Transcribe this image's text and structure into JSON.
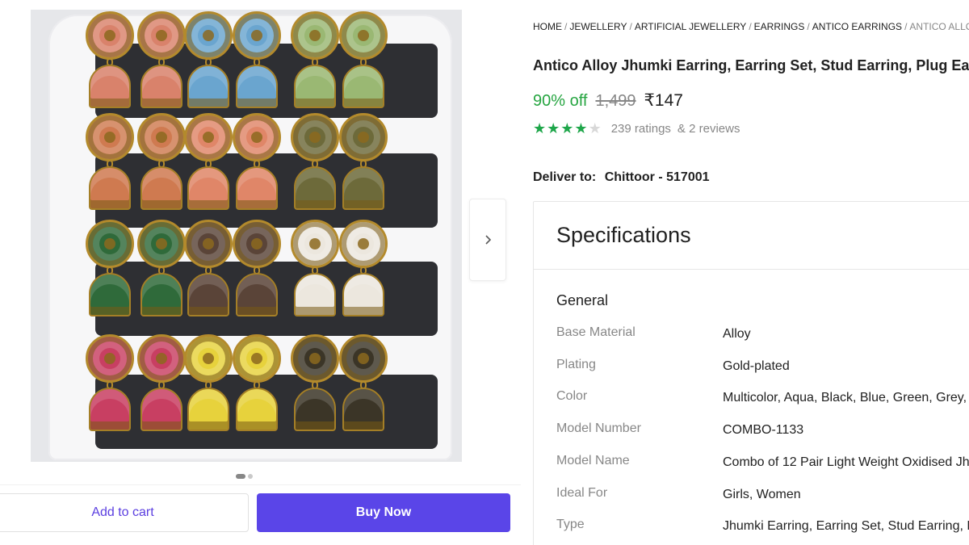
{
  "gallery": {
    "next_icon": "chevron-right-icon",
    "slider": {
      "count": 2,
      "active": 1
    },
    "earrings": {
      "rows": [
        [
          "#d9826b",
          "#d9826b",
          "#6aa5cf",
          "#6aa5cf",
          "#9ab873",
          "#9ab873"
        ],
        [
          "#cf7a50",
          "#cf7a50",
          "#e08668",
          "#e08668",
          "#6d6a3a",
          "#6d6a3a"
        ],
        [
          "#2f6a3a",
          "#2f6a3a",
          "#5a4438",
          "#5a4438",
          "#ece7de",
          "#ece7de"
        ],
        [
          "#c83f62",
          "#c83f62",
          "#e7d23c",
          "#e7d23c",
          "#3b3527",
          "#3b3527"
        ]
      ]
    }
  },
  "actions": {
    "add_to_cart": "Add to cart",
    "buy_now": "Buy Now"
  },
  "breadcrumb": {
    "items": [
      "HOME",
      "JEWELLERY",
      "ARTIFICIAL JEWELLERY",
      "EARRINGS",
      "ANTICO EARRINGS"
    ],
    "current": "ANTICO ALLOY J",
    "separator": "/"
  },
  "product": {
    "title": "Antico Alloy Jhumki Earring, Earring Set, Stud Earring, Plug Earr",
    "discount": "90% off",
    "mrp": "1,499",
    "price": "₹147",
    "rating": {
      "value": 4,
      "max": 5,
      "ratings_text": "239 ratings",
      "reviews_text": "& 2 reviews"
    }
  },
  "delivery": {
    "label": "Deliver to:",
    "location": "Chittoor - 517001"
  },
  "specifications": {
    "title": "Specifications",
    "group": "General",
    "rows": [
      {
        "key": "Base Material",
        "value": "Alloy"
      },
      {
        "key": "Plating",
        "value": "Gold-plated"
      },
      {
        "key": "Color",
        "value": "Multicolor, Aqua, Black, Blue, Green, Grey, M"
      },
      {
        "key": "Model Number",
        "value": "COMBO-1133"
      },
      {
        "key": "Model Name",
        "value": "Combo of 12 Pair Light Weight Oxidised Jh"
      },
      {
        "key": "Ideal For",
        "value": "Girls, Women"
      },
      {
        "key": "Type",
        "value": "Jhumki Earring, Earring Set, Stud Earring, Pl"
      }
    ]
  },
  "colors": {
    "accent": "#5a45e8",
    "discount_green": "#26a541",
    "muted": "#878787"
  }
}
